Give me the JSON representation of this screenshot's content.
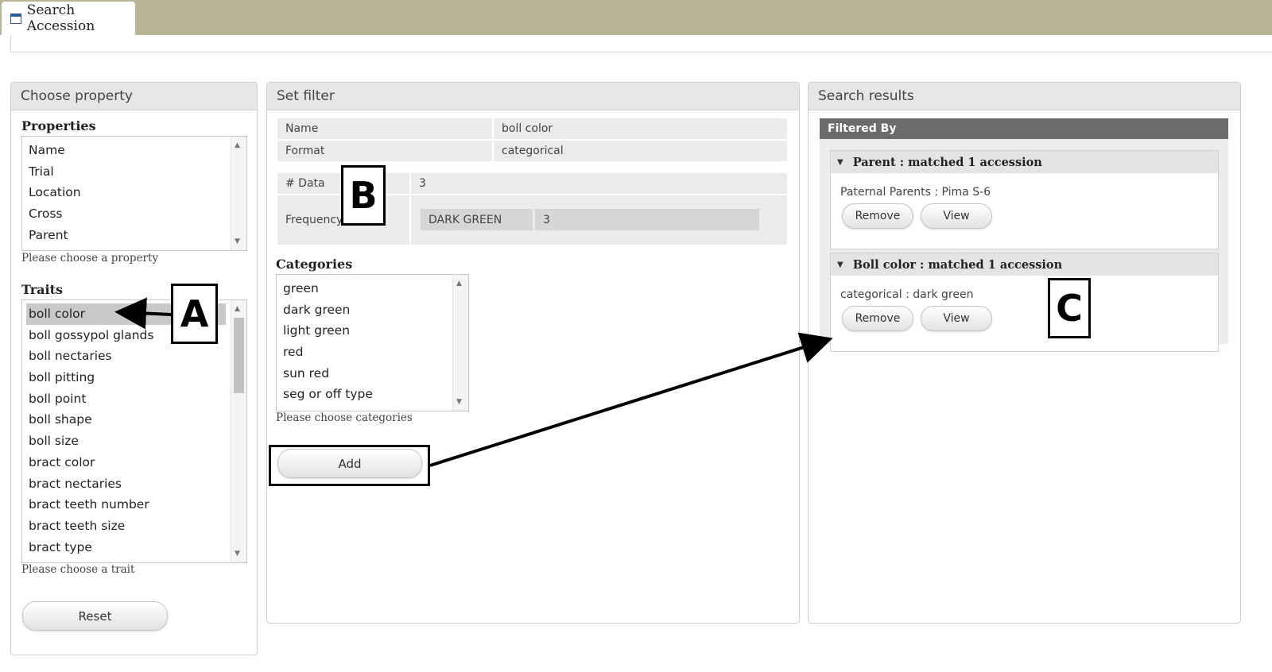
{
  "window": {
    "tab_label": "Search Accession",
    "tab_icon": "window-icon"
  },
  "choose_property": {
    "header": "Choose property",
    "properties_title": "Properties",
    "properties": [
      "Name",
      "Trial",
      "Location",
      "Cross",
      "Parent"
    ],
    "properties_hint": "Please choose a property",
    "traits_title": "Traits",
    "traits": [
      "boll color",
      "boll gossypol glands",
      "boll nectaries",
      "boll pitting",
      "boll point",
      "boll shape",
      "boll size",
      "bract color",
      "bract nectaries",
      "bract teeth number",
      "bract teeth size",
      "bract type"
    ],
    "selected_trait": "boll color",
    "traits_hint": "Please choose a trait",
    "reset_label": "Reset"
  },
  "set_filter": {
    "header": "Set filter",
    "name_label": "Name",
    "name_value": "boll color",
    "format_label": "Format",
    "format_value": "categorical",
    "data_label": "# Data",
    "data_value": "3",
    "frequency_label": "Frequency",
    "frequency_key": "DARK GREEN",
    "frequency_value": "3",
    "categories_title": "Categories",
    "categories": [
      "green",
      "dark green",
      "light green",
      "red",
      "sun red",
      "seg or off type"
    ],
    "categories_hint": "Please choose categories",
    "add_label": "Add"
  },
  "search_results": {
    "header": "Search results",
    "filtered_by": "Filtered By",
    "groups": [
      {
        "title": "Parent : matched 1 accession",
        "detail": "Paternal Parents : Pima S-6",
        "remove_label": "Remove",
        "view_label": "View"
      },
      {
        "title": "Boll color : matched 1 accession",
        "detail": "categorical : dark green",
        "remove_label": "Remove",
        "view_label": "View"
      }
    ]
  },
  "annotations": {
    "a": "A",
    "b": "B",
    "c": "C"
  },
  "colors": {
    "top_bar": "#b9b495",
    "panel_header": "#e6e6e6",
    "filtered_bar": "#6b6b6b",
    "selected_row": "#c9c9c9"
  }
}
